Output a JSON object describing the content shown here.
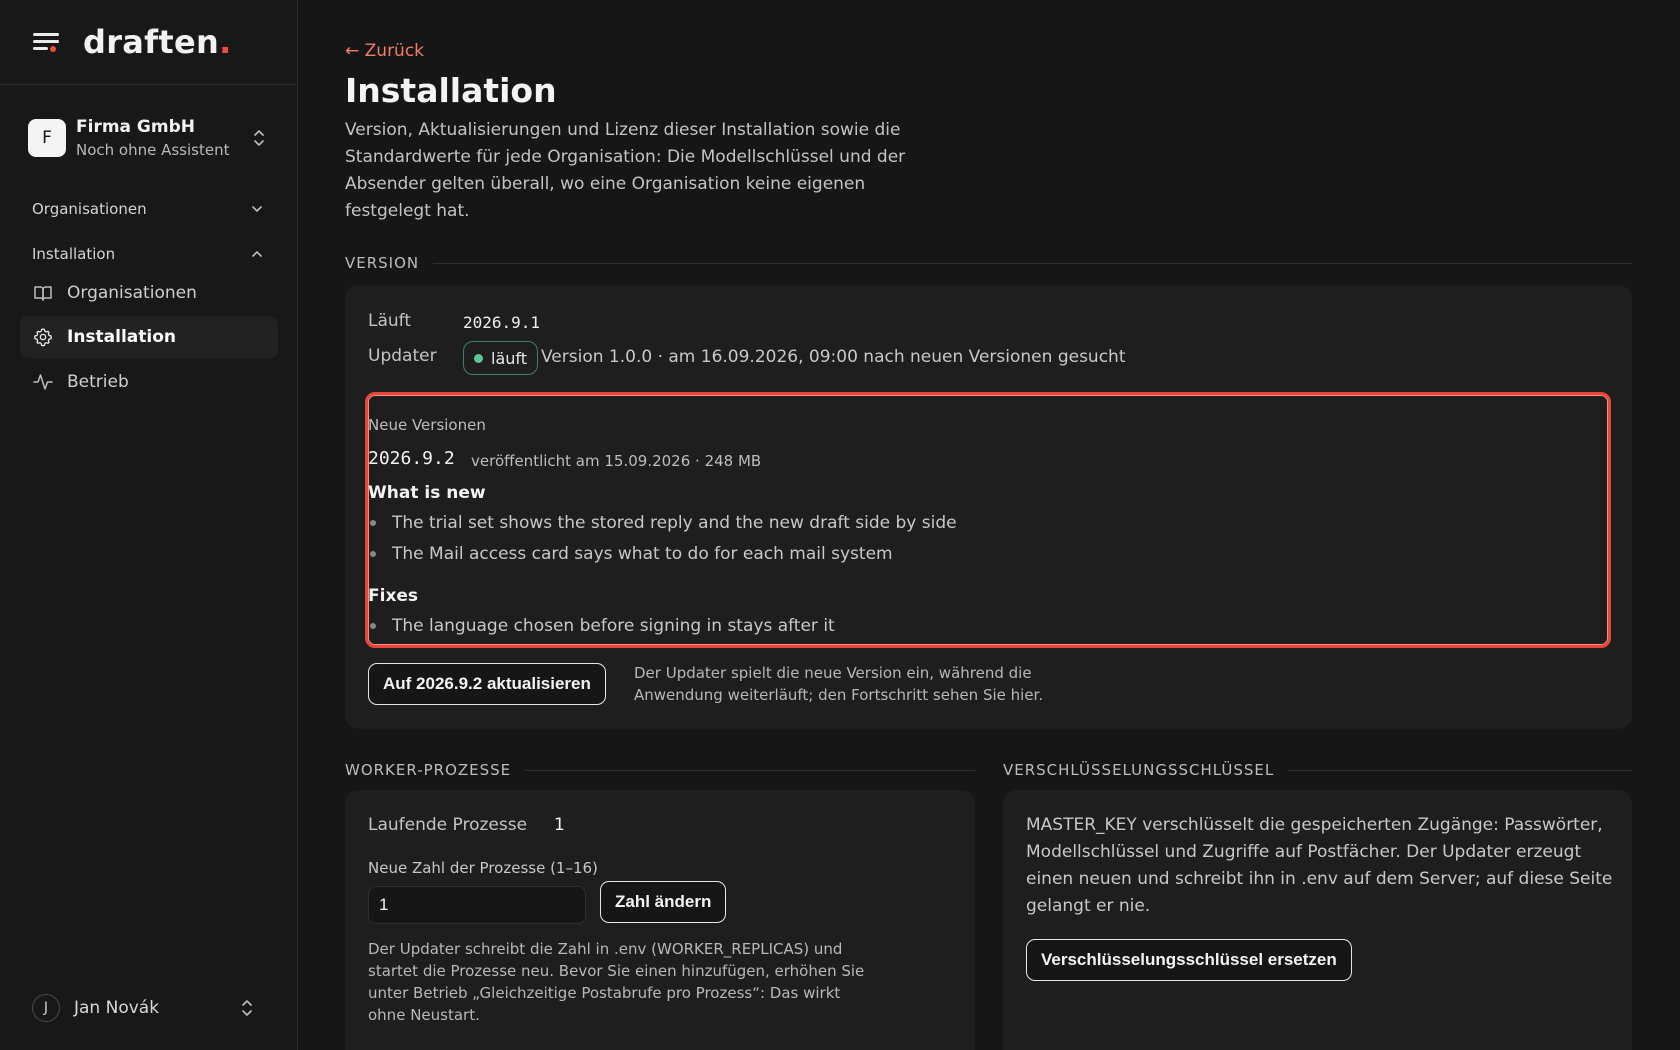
{
  "app": {
    "logo_text": "draften",
    "logo_dot": "."
  },
  "org_switcher": {
    "avatar_letter": "F",
    "name": "Firma GmbH",
    "subtitle": "Noch ohne Assistent"
  },
  "sidebar": {
    "group_organisations": "Organisationen",
    "group_installation": "Installation",
    "items": [
      {
        "label": "Organisationen",
        "icon": "book-icon"
      },
      {
        "label": "Installation",
        "icon": "gear-icon",
        "active": true
      },
      {
        "label": "Betrieb",
        "icon": "activity-icon"
      }
    ]
  },
  "user": {
    "avatar_letter": "J",
    "name": "Jan Novák"
  },
  "page": {
    "back_label": "← Zurück",
    "title": "Installation",
    "description": "Version, Aktualisierungen und Lizenz dieser Installation sowie die Standardwerte für jede Organisation: Die Modellschlüssel und der Absender gelten überall, wo eine Organisation keine eigenen festgelegt hat."
  },
  "version": {
    "section_label": "VERSION",
    "running_label": "Läuft",
    "running_value": "2026.9.1",
    "updater_label": "Updater",
    "updater_status": "läuft",
    "updater_info": "Version 1.0.0 · am 16.09.2026, 09:00 nach neuen Versionen gesucht",
    "new_versions": {
      "caption": "Neue Versionen",
      "version": "2026.9.2",
      "meta": "veröffentlicht am 15.09.2026 · 248 MB",
      "whats_new_heading": "What is new",
      "whats_new": [
        "The trial set shows the stored reply and the new draft side by side",
        "The Mail access card says what to do for each mail system"
      ],
      "fixes_heading": "Fixes",
      "fixes": [
        "The language chosen before signing in stays after it"
      ]
    },
    "update_button": "Auf 2026.9.2 aktualisieren",
    "update_hint": "Der Updater spielt die neue Version ein, während die Anwendung weiterläuft; den Fortschritt sehen Sie hier."
  },
  "workers": {
    "section_label": "WORKER-PROZESSE",
    "running_label": "Laufende Prozesse",
    "running_value": "1",
    "input_label": "Neue Zahl der Prozesse (1–16)",
    "input_value": "1",
    "change_button": "Zahl ändern",
    "hint": "Der Updater schreibt die Zahl in .env (WORKER_REPLICAS) und startet die Prozesse neu. Bevor Sie einen hinzufügen, erhöhen Sie unter Betrieb „Gleichzeitige Postabrufe pro Prozess“: Das wirkt ohne Neustart."
  },
  "encryption": {
    "section_label": "VERSCHLÜSSELUNGSSCHLÜSSEL",
    "description": "MASTER_KEY verschlüsselt die gespeicherten Zugänge: Passwörter, Modellschlüssel und Zugriffe auf Postfächer. Der Updater erzeugt einen neuen und schreibt ihn in .env auf dem Server; auf diese Seite gelangt er nie.",
    "replace_button": "Verschlüsselungsschlüssel ersetzen"
  },
  "colors": {
    "accent": "#f07d63",
    "brand_dot": "#ef4b3c",
    "status_ok": "#5fc593",
    "highlight_border": "#e5483a"
  }
}
